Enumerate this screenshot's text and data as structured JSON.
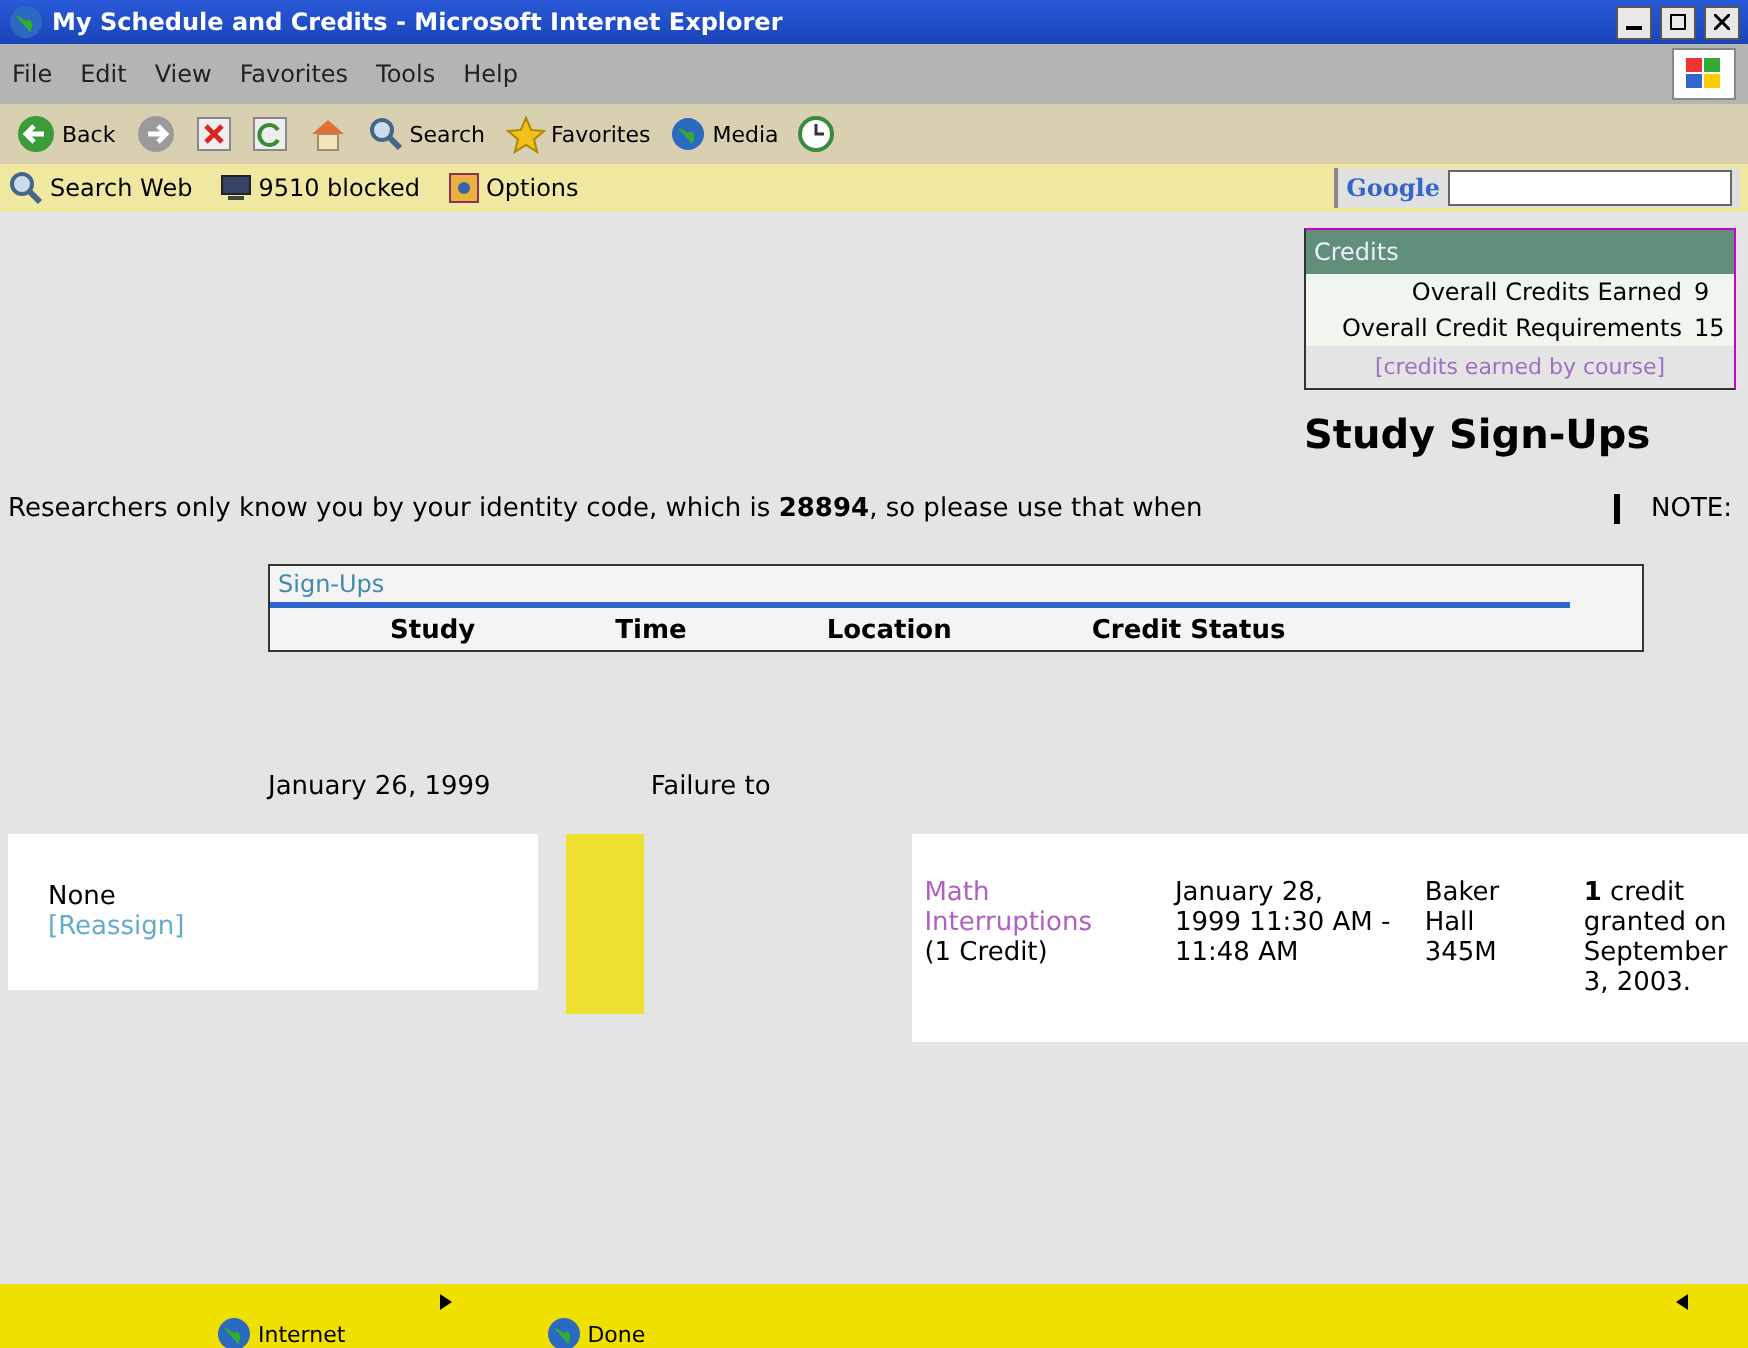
{
  "window": {
    "title": "My Schedule and Credits - Microsoft Internet Explorer"
  },
  "menu": [
    "File",
    "Edit",
    "View",
    "Favorites",
    "Tools",
    "Help"
  ],
  "toolbar": [
    {
      "kind": "back",
      "label": "Back"
    },
    {
      "kind": "forward"
    },
    {
      "kind": "stop"
    },
    {
      "kind": "refresh"
    },
    {
      "kind": "home"
    },
    {
      "kind": "search",
      "label": "Search"
    },
    {
      "kind": "favorites",
      "label": "Favorites"
    },
    {
      "kind": "media",
      "label": "Media"
    },
    {
      "kind": "history"
    }
  ],
  "links_bar": {
    "items": [
      {
        "kind": "search",
        "label": "Search Web"
      },
      {
        "kind": "blocked",
        "label": "9510 blocked"
      },
      {
        "kind": "options",
        "label": "Options"
      }
    ],
    "search_brand": "Google"
  },
  "credits": {
    "title": "Credits",
    "rows": [
      {
        "label": "Overall Credits Earned",
        "value": "9"
      },
      {
        "label": "Overall Credit Requirements",
        "value": "15"
      }
    ],
    "link": "[credits earned by course]"
  },
  "heading": "Study Sign-Ups",
  "identity_note": "Researchers only know you by your identity code, which is **28894**, so please use that when",
  "note_label": "NOTE:",
  "signups": {
    "title": "Sign-Ups",
    "columns": [
      "Study",
      "Time",
      "Location",
      "Credit Status"
    ]
  },
  "row": {
    "date": "January 26, 1999",
    "status": "Failure to"
  },
  "assignment": {
    "value": "None",
    "link": "[Reassign]"
  },
  "completed": {
    "study": "Math Interruptions",
    "credit": "(1 Credit)",
    "time": "January 28, 1999 11:30 AM - 11:48 AM",
    "location": "Baker Hall 345M",
    "status": "**1** credit granted on September 3, 2003."
  },
  "status_bar": {
    "text": "Done",
    "zone": "Internet"
  }
}
